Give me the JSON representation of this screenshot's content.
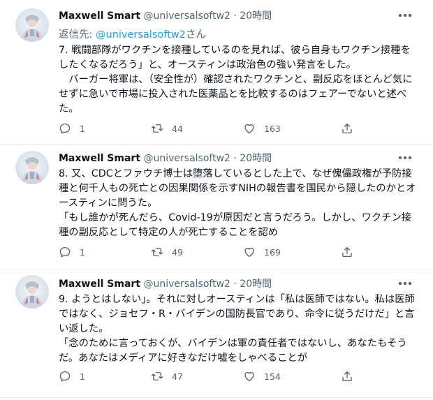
{
  "tweets": [
    {
      "name": "Maxwell Smart",
      "handle": "@universalsoftw2",
      "dot": "·",
      "time": "20時間",
      "reply_prefix": "返信先: ",
      "reply_handle": "@universalsoftw2",
      "reply_suffix": "さん",
      "text": "7. 戦闘部隊がワクチンを接種しているのを見れば、彼ら自身もワクチン接種をしたくなるだろう」と、オースティンは政治色の強い発言をした。\n　バーガー将軍は、（安全性が）確認されたワクチンと、副反応をほとんど気にせずに急いで市場に投入された医薬品とを比較するのはフェアーでないと述べた。",
      "replies": "1",
      "retweets": "44",
      "likes": "163"
    },
    {
      "name": "Maxwell Smart",
      "handle": "@universalsoftw2",
      "dot": "·",
      "time": "20時間",
      "text": "8. 又、CDCとファウチ博士は堕落しているとした上で、なぜ傀儡政権が予防接種と何千人もの死亡との因果関係を示すNIHの報告書を国民から隠したのかとオースティンに問うた。\n「もし誰かが死んだら、Covid-19が原因だと言うだろう。しかし、ワクチン接種の副反応として特定の人が死亡することを認め",
      "replies": "1",
      "retweets": "49",
      "likes": "169"
    },
    {
      "name": "Maxwell Smart",
      "handle": "@universalsoftw2",
      "dot": "·",
      "time": "20時間",
      "text": "9. ようとはしない」。それに対しオースティンは「私は医師ではない。私は医師ではなく、ジョセフ・R・バイデンの国防長官であり、命令に従うだけだ」と言い返した。\n「念のために言っておくが、バイデンは軍の責任者ではないし、あなたもそうだ。あなたはメディアに好きなだけ嘘をしゃべることが",
      "replies": "1",
      "retweets": "47",
      "likes": "154"
    }
  ],
  "colors": {
    "text": "#0f1419",
    "secondary": "#536471",
    "link": "#1d9bf0",
    "divider": "#e6e9ec",
    "background": "#ffffff"
  }
}
